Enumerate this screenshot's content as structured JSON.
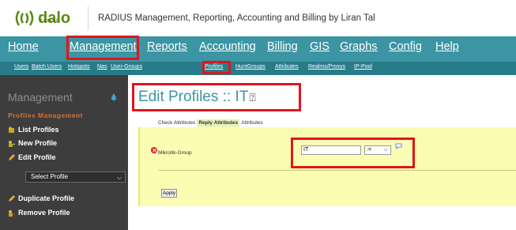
{
  "header": {
    "logo_text": "dalo",
    "logo_sub": "RADIUS",
    "title": "RADIUS Management, Reporting, Accounting and Billing by Liran Tal"
  },
  "nav": {
    "items": [
      "Home",
      "Management",
      "Reports",
      "Accounting",
      "Billing",
      "GIS",
      "Graphs",
      "Config",
      "Help"
    ]
  },
  "subnav": {
    "items": [
      "Users",
      "Batch Users",
      "Hotspots",
      "Nas",
      "User-Groups",
      "Profiles",
      "HuntGroups",
      "Attributes",
      "Realms/Proxys",
      "IP-Pool"
    ]
  },
  "sidebar": {
    "title": "Management",
    "section": "Profiles Management",
    "links": [
      "List Profiles",
      "New Profile",
      "Edit Profile",
      "Duplicate Profile",
      "Remove Profile"
    ],
    "select_label": "Select Profile"
  },
  "content": {
    "title": "Edit Profiles :: IT",
    "help_icon": "question-icon",
    "tabs": [
      "Check Attributes",
      "Reply Attributes",
      "Attributes"
    ],
    "active_tab": "Reply Attributes",
    "attribute": {
      "name": "Mikrotik-Group",
      "value": "IT",
      "operator": ":="
    },
    "apply_label": "Apply"
  },
  "colors": {
    "nav_bg": "#3b95a3",
    "subnav_bg": "#287c89",
    "sidebar_bg": "#3d3d3d",
    "accent_orange": "#e06d2f",
    "panel_bg": "#fbfdb3",
    "highlight": "#e0151d",
    "logo_green": "#5a8a13"
  }
}
